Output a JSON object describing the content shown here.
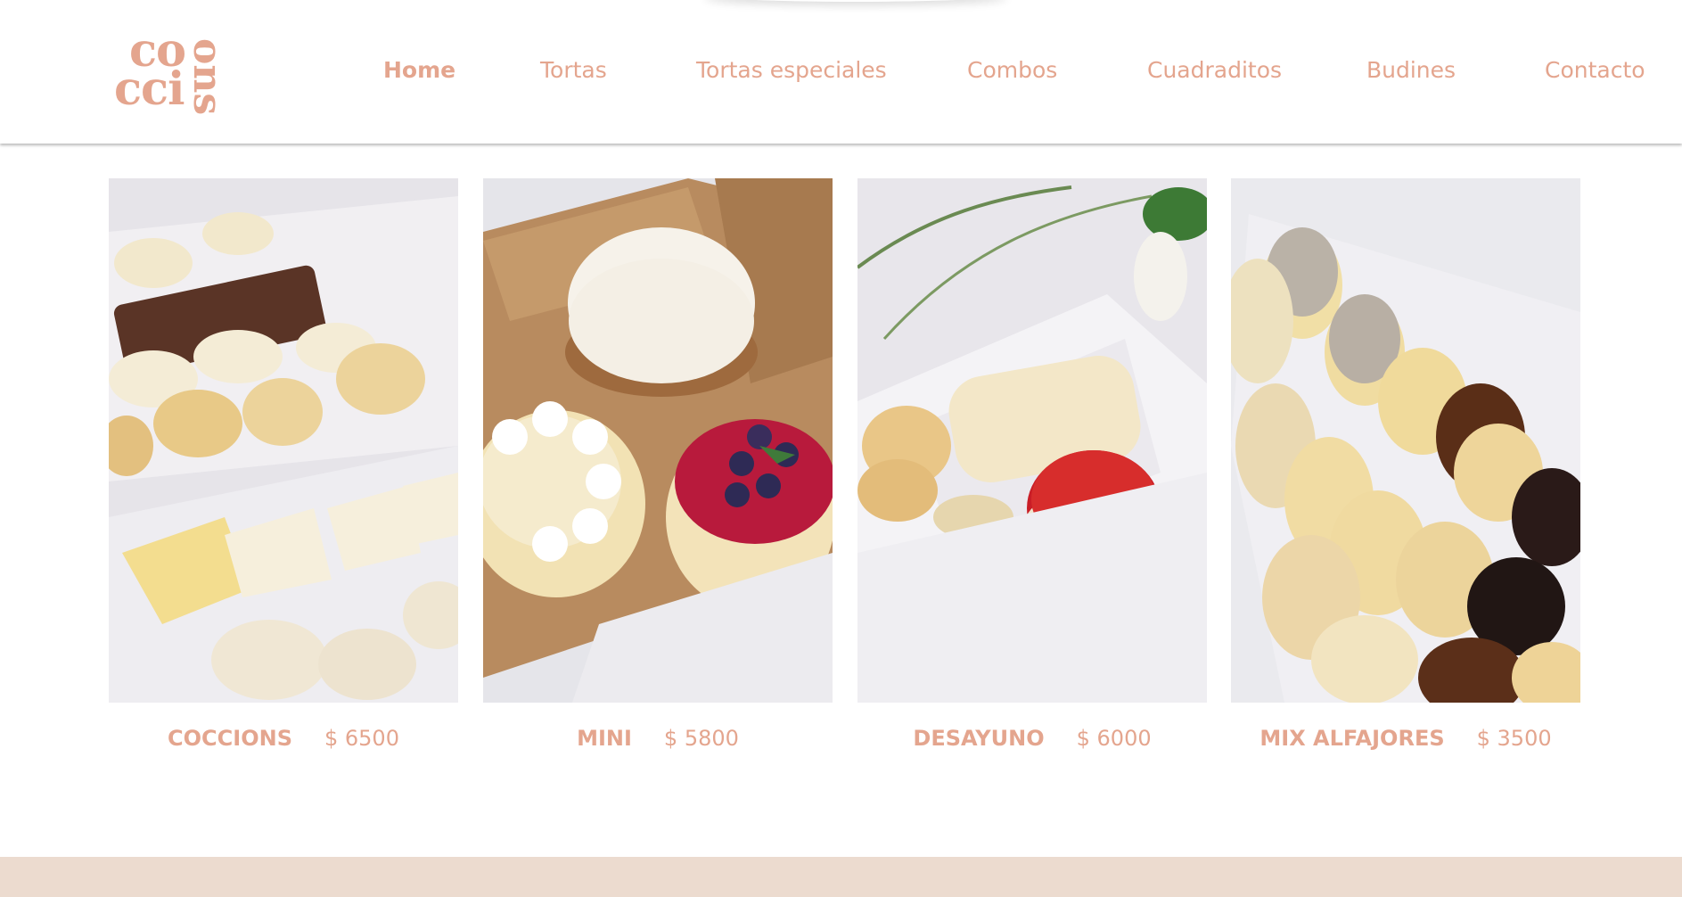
{
  "logo": {
    "line1": "co",
    "line2": "cci",
    "side": "ons"
  },
  "nav": {
    "items": [
      {
        "label": "Home",
        "active": true
      },
      {
        "label": "Tortas"
      },
      {
        "label": "Tortas especiales"
      },
      {
        "label": "Combos"
      },
      {
        "label": "Cuadraditos"
      },
      {
        "label": "Budines"
      },
      {
        "label": "Contacto"
      }
    ]
  },
  "products": [
    {
      "name": "COCCIONS",
      "price": "$ 6500"
    },
    {
      "name": "MINI",
      "price": "$ 5800"
    },
    {
      "name": "DESAYUNO",
      "price": "$ 6000"
    },
    {
      "name": "MIX ALFAJORES",
      "price": "$ 3500"
    }
  ],
  "colors": {
    "accent": "#e4a58e",
    "footer": "#ecdbcf",
    "background": "#ffffff"
  }
}
